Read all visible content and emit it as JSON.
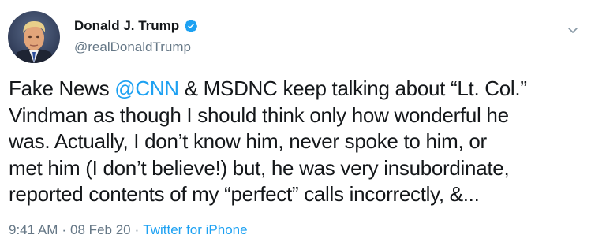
{
  "tweet": {
    "author": {
      "display_name": "Donald J. Trump",
      "handle": "@realDonaldTrump",
      "verified": true
    },
    "text_lines": [
      {
        "before": "Fake News ",
        "mention": "@CNN",
        "after": " & MSDNC keep talking about “Lt. Col.”"
      },
      {
        "text": "Vindman as though I should think only how wonderful he"
      },
      {
        "text": "was. Actually, I don’t know him, never spoke to him, or"
      },
      {
        "text": "met him (I don’t believe!) but, he was very insubordinate,"
      },
      {
        "text": "reported contents of my “perfect” calls incorrectly, &..."
      }
    ],
    "time": "9:41 AM",
    "separator_1": "·",
    "date": "08 Feb 20",
    "separator_2": "·",
    "source": "Twitter for iPhone"
  },
  "colors": {
    "link": "#1da1f2",
    "secondary_text": "#657786",
    "primary_text": "#14171a",
    "verified_badge": "#1da1f2"
  },
  "icons": {
    "verified": "verified-badge-icon",
    "menu": "chevron-down-icon",
    "avatar": "profile-photo"
  }
}
